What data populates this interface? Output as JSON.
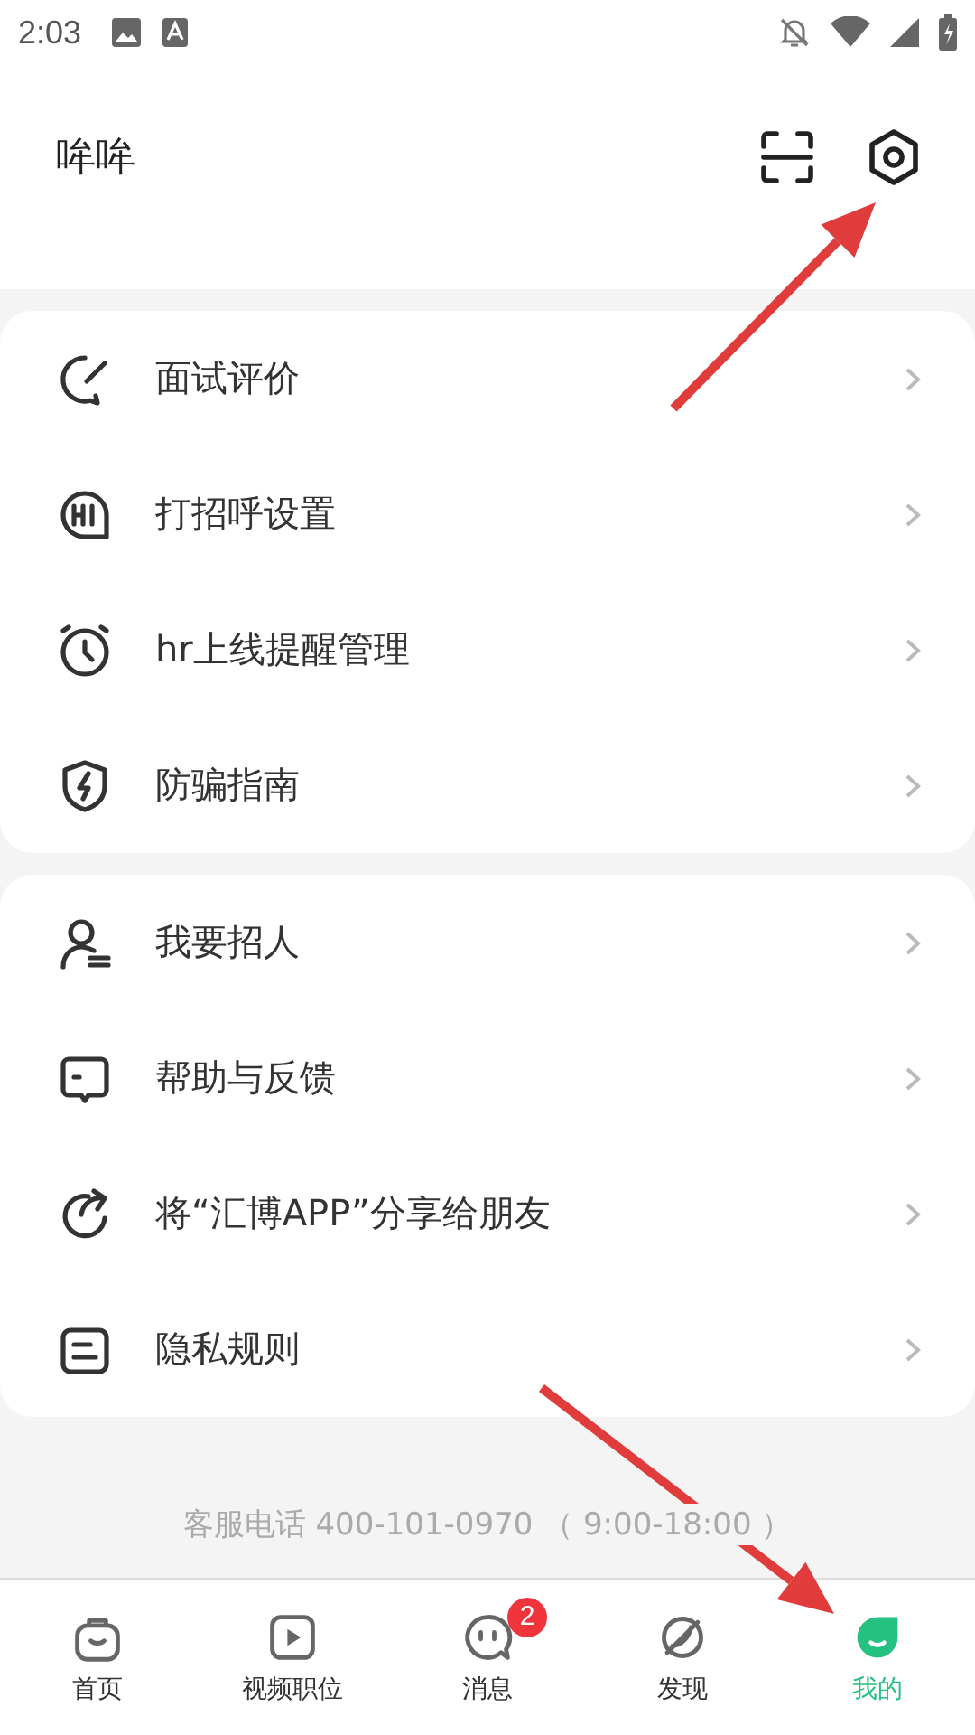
{
  "status_bar": {
    "time": "2:03"
  },
  "header": {
    "title": "哞哞"
  },
  "menu_groups": [
    {
      "items": [
        {
          "label": "面试评价"
        },
        {
          "label": "打招呼设置"
        },
        {
          "label": "hr上线提醒管理"
        },
        {
          "label": "防骗指南"
        }
      ]
    },
    {
      "items": [
        {
          "label": "我要招人"
        },
        {
          "label": "帮助与反馈"
        },
        {
          "label": "将“汇博APP”分享给朋友"
        },
        {
          "label": "隐私规则"
        }
      ]
    }
  ],
  "footer": {
    "hotline": "客服电话 400-101-0970 （ 9:00-18:00 ）"
  },
  "tab_bar": [
    {
      "label": "首页",
      "selected": false
    },
    {
      "label": "视频职位",
      "selected": false
    },
    {
      "label": "消息",
      "selected": false,
      "badge": "2"
    },
    {
      "label": "发现",
      "selected": false
    },
    {
      "label": "我的",
      "selected": true
    }
  ],
  "annotations": [
    {
      "kind": "arrow"
    },
    {
      "kind": "arrow"
    }
  ]
}
